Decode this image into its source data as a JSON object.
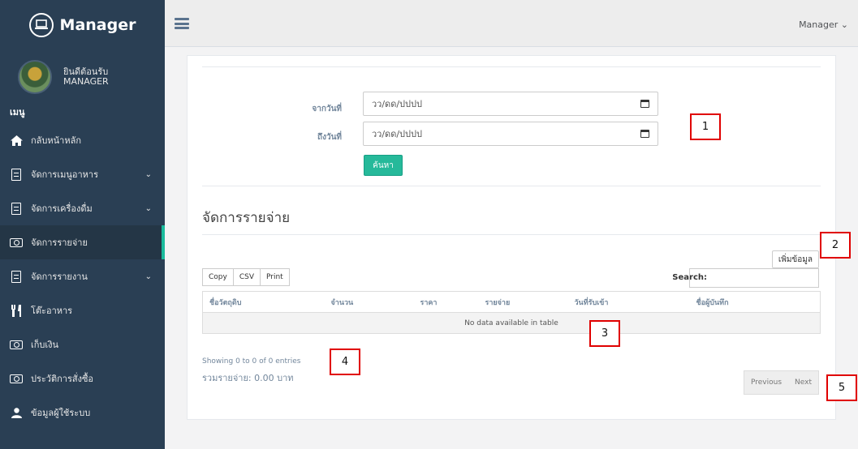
{
  "brand": {
    "title": "Manager"
  },
  "profile": {
    "welcome": "ยินดีต้อนรับ",
    "username": "MANAGER"
  },
  "sidebar": {
    "menu_title": "เมนู",
    "items": [
      {
        "label": "กลับหน้าหลัก",
        "icon": "home-icon"
      },
      {
        "label": "จัดการเมนูอาหาร",
        "icon": "document-icon",
        "chevron": "⌄"
      },
      {
        "label": "จัดการเครื่องดื่ม",
        "icon": "document-icon",
        "chevron": "⌄"
      },
      {
        "label": "จัดการรายจ่าย",
        "icon": "money-icon",
        "active": true
      },
      {
        "label": "จัดการรายงาน",
        "icon": "document-icon",
        "chevron": "⌄"
      },
      {
        "label": "โต๊ะอาหาร",
        "icon": "utensils-icon"
      },
      {
        "label": "เก็บเงิน",
        "icon": "money-icon"
      },
      {
        "label": "ประวัติการสั่งซื้อ",
        "icon": "money-icon"
      },
      {
        "label": "ข้อมูลผู้ใช้ระบบ",
        "icon": "user-icon"
      }
    ]
  },
  "topbar": {
    "user_menu": "Manager ⌄"
  },
  "filter": {
    "from_label": "จากวันที่",
    "to_label": "ถึงวันที่",
    "from_value": "วว/ดด/ปปปป",
    "to_value": "วว/ดด/ปปปป",
    "search_button": "ค้นหา"
  },
  "section": {
    "title": "จัดการรายจ่าย",
    "add_button": "เพิ่มข้อมูล"
  },
  "table": {
    "export_buttons": [
      "Copy",
      "CSV",
      "Print"
    ],
    "search_label": "Search:",
    "columns": [
      "ชื่อวัตถุดิบ",
      "จำนวน",
      "ราคา",
      "รายจ่าย",
      "วันที่รับเข้า",
      "ชื่อผู้บันทึก"
    ],
    "empty_message": "No data available in table",
    "showing": "Showing 0 to 0 of 0 entries",
    "total": "รวมรายจ่าย: 0.00 บาท",
    "prev": "Previous",
    "next": "Next"
  },
  "annotations": [
    "1",
    "2",
    "3",
    "4",
    "5"
  ],
  "colors": {
    "sidebar": "#2a3f54",
    "accent": "#1abb9c",
    "button": "#26b99a",
    "annotation": "#e00000"
  }
}
